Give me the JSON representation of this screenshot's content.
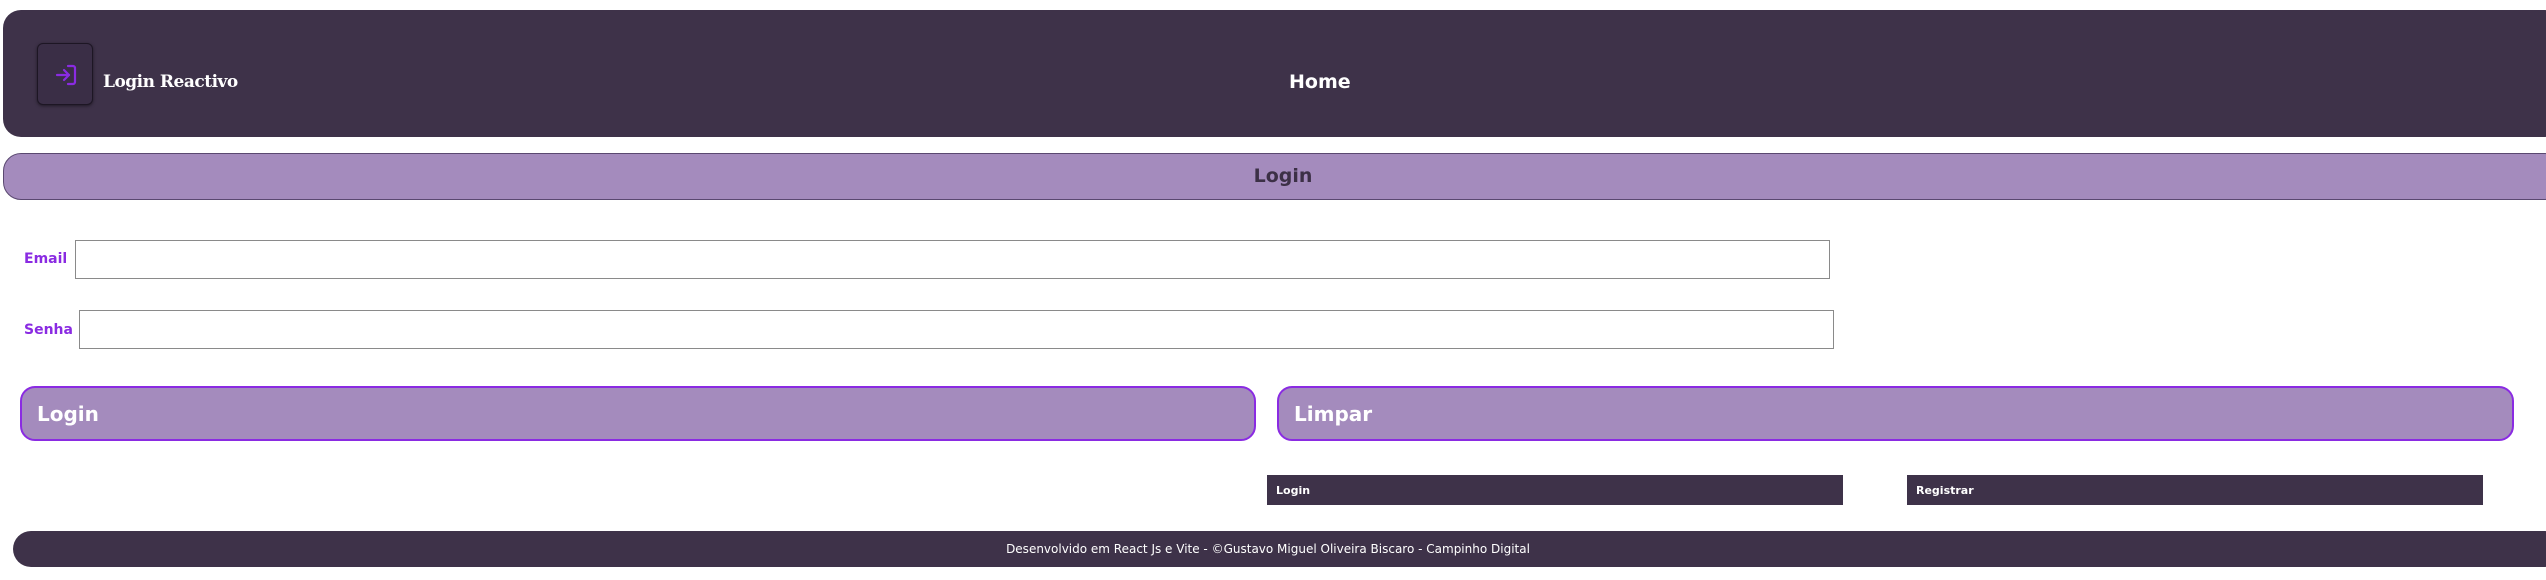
{
  "header": {
    "brand": "Login Reactivo",
    "logo_icon": "login-arrow-icon",
    "nav_home": "Home"
  },
  "page": {
    "title": "Login"
  },
  "form": {
    "email_label": "Email",
    "email_value": "",
    "senha_label": "Senha",
    "senha_value": "",
    "login_button": "Login",
    "clear_button": "Limpar"
  },
  "links": {
    "login": "Login",
    "register": "Registrar"
  },
  "footer": {
    "text": "Desenvolvido em React Js e Vite - ©Gustavo Miguel Oliveira Biscaro - Campinho Digital"
  },
  "colors": {
    "header_bg": "#3e3249",
    "accent_purple": "#a48bbd",
    "label_violet": "#8a2be2"
  }
}
